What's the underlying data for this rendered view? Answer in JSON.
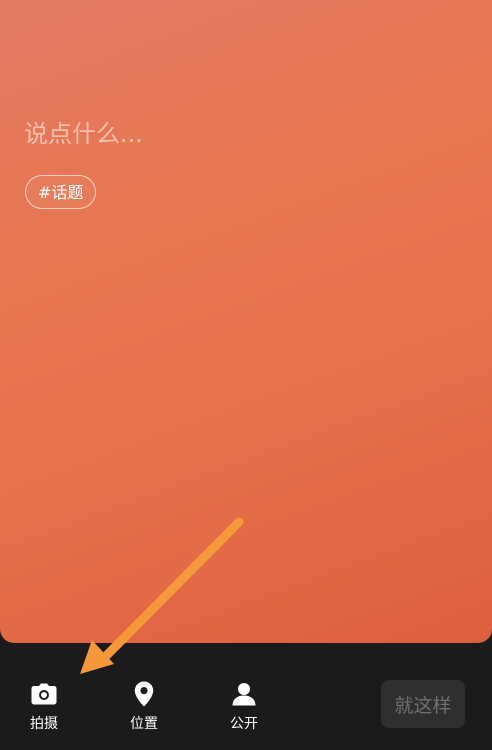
{
  "compose": {
    "placeholder": "说点什么...",
    "topic_label": "#话题",
    "background_colors": [
      "#e27a64",
      "#e8764f",
      "#dd5f3d"
    ]
  },
  "toolbar": {
    "items": [
      {
        "label": "拍摄",
        "icon": "camera-icon"
      },
      {
        "label": "位置",
        "icon": "location-pin-icon"
      },
      {
        "label": "公开",
        "icon": "person-icon"
      }
    ],
    "submit_label": "就这样",
    "background_color": "#1b1b1b"
  },
  "annotation": {
    "arrow_color": "#f5973a",
    "points_to": "拍摄"
  }
}
